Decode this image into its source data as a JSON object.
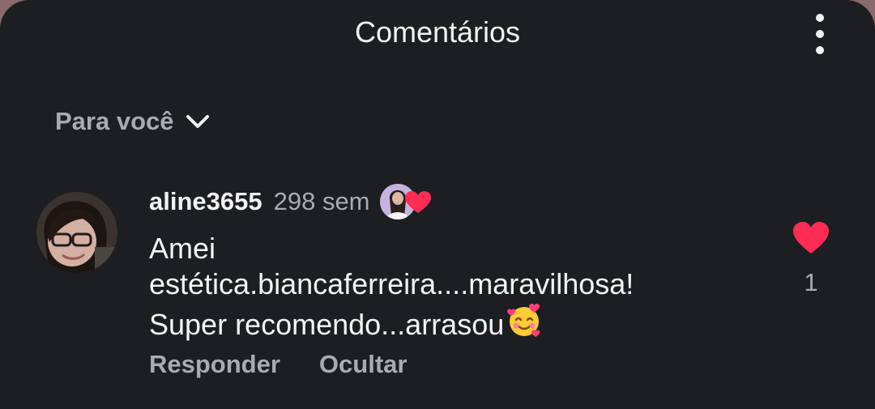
{
  "header": {
    "title": "Comentários",
    "menu_icon": "more-vertical-icon"
  },
  "filter": {
    "label": "Para você",
    "icon": "chevron-down-icon"
  },
  "comment": {
    "username": "aline3655",
    "time": "298 sem",
    "lines": [
      "Amei",
      "estética.biancaferreira....maravilhosa!",
      "Super recomendo...arrasou"
    ],
    "emoji": "smiling-face-with-hearts-icon",
    "creator_liked_icon": "creator-heart-icon",
    "like_count": "1",
    "actions": {
      "reply": "Responder",
      "hide": "Ocultar"
    }
  },
  "colors": {
    "background": "#1c1e21",
    "text": "#f2f2f2",
    "muted": "#a8abb2",
    "heart": "#fe2c55"
  }
}
